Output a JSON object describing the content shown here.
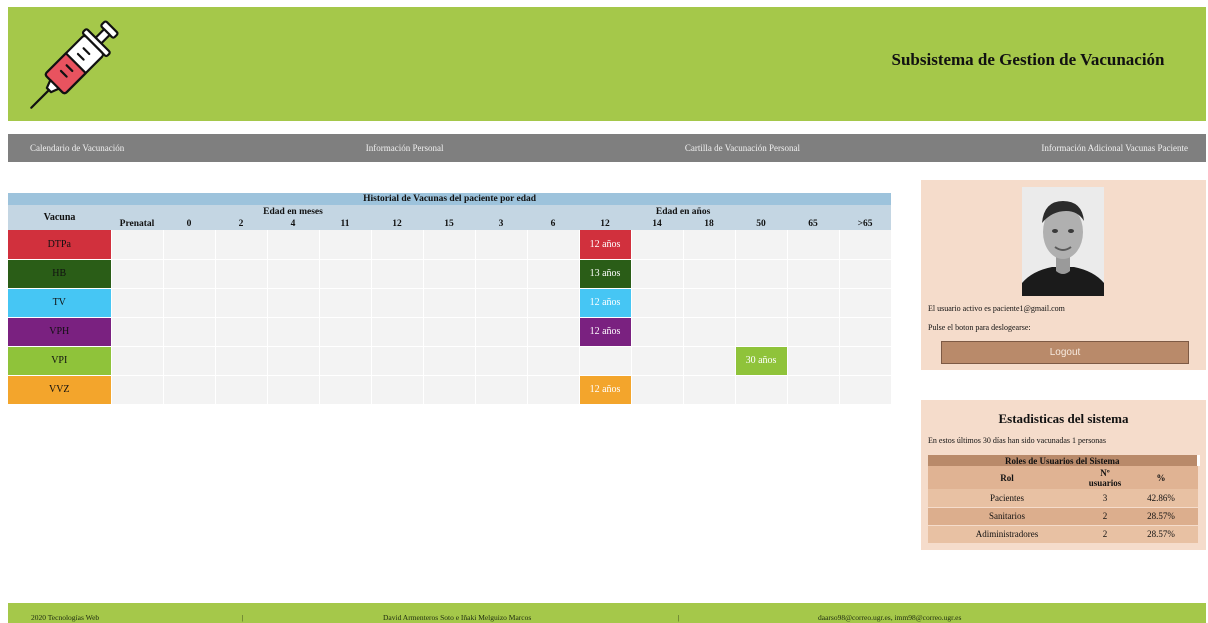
{
  "header": {
    "title": "Subsistema de Gestion de Vacunación",
    "logo_icon": "syringe-icon",
    "background": "#a5c84a"
  },
  "nav": {
    "items": [
      {
        "label": "Calendario de Vacunación"
      },
      {
        "label": "Información Personal"
      },
      {
        "label": "Cartilla de Vacunación Personal"
      },
      {
        "label": "Información Adicional Vacunas Paciente"
      }
    ]
  },
  "history": {
    "caption": "Historial de Vacunas del paciente por edad",
    "vaccine_header": "Vacuna",
    "months_header": "Edad en meses",
    "years_header": "Edad en años",
    "month_columns": [
      "Prenatal",
      "0",
      "2",
      "4",
      "11",
      "12",
      "15"
    ],
    "year_columns": [
      "3",
      "6",
      "12",
      "14",
      "18",
      "50",
      "65",
      ">65"
    ],
    "rows": [
      {
        "name": "DTPa",
        "color": "#d1303d",
        "cells": [
          "",
          "",
          "",
          "",
          "",
          "",
          "",
          "",
          "",
          "12 años",
          "",
          "",
          "",
          "",
          ""
        ]
      },
      {
        "name": "HB",
        "color": "#2a5d17",
        "cells": [
          "",
          "",
          "",
          "",
          "",
          "",
          "",
          "",
          "",
          "13 años",
          "",
          "",
          "",
          "",
          ""
        ]
      },
      {
        "name": "TV",
        "color": "#46c6f4",
        "cells": [
          "",
          "",
          "",
          "",
          "",
          "",
          "",
          "",
          "",
          "12 años",
          "",
          "",
          "",
          "",
          ""
        ]
      },
      {
        "name": "VPH",
        "color": "#7a2180",
        "cells": [
          "",
          "",
          "",
          "",
          "",
          "",
          "",
          "",
          "",
          "12 años",
          "",
          "",
          "",
          "",
          ""
        ]
      },
      {
        "name": "VPI",
        "color": "#8fc33a",
        "cells": [
          "",
          "",
          "",
          "",
          "",
          "",
          "",
          "",
          "",
          "",
          "",
          "",
          "30 años",
          "",
          ""
        ]
      },
      {
        "name": "VVZ",
        "color": "#f3a52c",
        "cells": [
          "",
          "",
          "",
          "",
          "",
          "",
          "",
          "",
          "",
          "12 años",
          "",
          "",
          "",
          "",
          ""
        ]
      }
    ]
  },
  "profile": {
    "active_user_text": "El usuario activo es paciente1@gmail.com",
    "logout_hint": "Pulse el boton para deslogearse:",
    "logout_label": "Logout"
  },
  "stats": {
    "title": "Estadisticas del sistema",
    "text": "En estos últimos 30 días han sido vacunadas 1 personas",
    "table_caption": "Roles de Usuarios del Sistema",
    "headers": {
      "role": "Rol",
      "count": "Nº usuarios",
      "pct": "%"
    },
    "rows": [
      {
        "role": "Pacientes",
        "count": "3",
        "pct": "42.86%"
      },
      {
        "role": "Sanitarios",
        "count": "2",
        "pct": "28.57%"
      },
      {
        "role": "Adiministradores",
        "count": "2",
        "pct": "28.57%"
      }
    ]
  },
  "footer": {
    "copyright": "2020 Tecnologías Web",
    "separator": "|",
    "authors": "David Armenteros Soto e Iñaki Melguizo Marcos",
    "emails": "daarso98@correo.ugr.es, imm98@correo.ugr.es"
  }
}
